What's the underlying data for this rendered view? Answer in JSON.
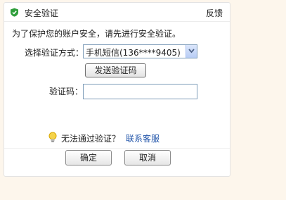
{
  "dialog": {
    "title": "安全验证",
    "feedback_label": "反馈"
  },
  "form": {
    "notice": "为了保护您的账户安全，请先进行安全验证。",
    "method_label": "选择验证方式：",
    "method_selected": "手机短信(136****9405)",
    "send_code_label": "发送验证码",
    "code_label": "验证码：",
    "code_value": ""
  },
  "help": {
    "text": "无法通过验证？",
    "link": "联系客服"
  },
  "buttons": {
    "ok": "确定",
    "cancel": "取消"
  },
  "colors": {
    "page_background": "#fdf6ec",
    "link": "#2255aa",
    "shield": "#2e9e3a"
  },
  "icons": {
    "title": "shield-check-icon",
    "help": "lightbulb-icon",
    "dropdown": "chevron-down-icon"
  }
}
